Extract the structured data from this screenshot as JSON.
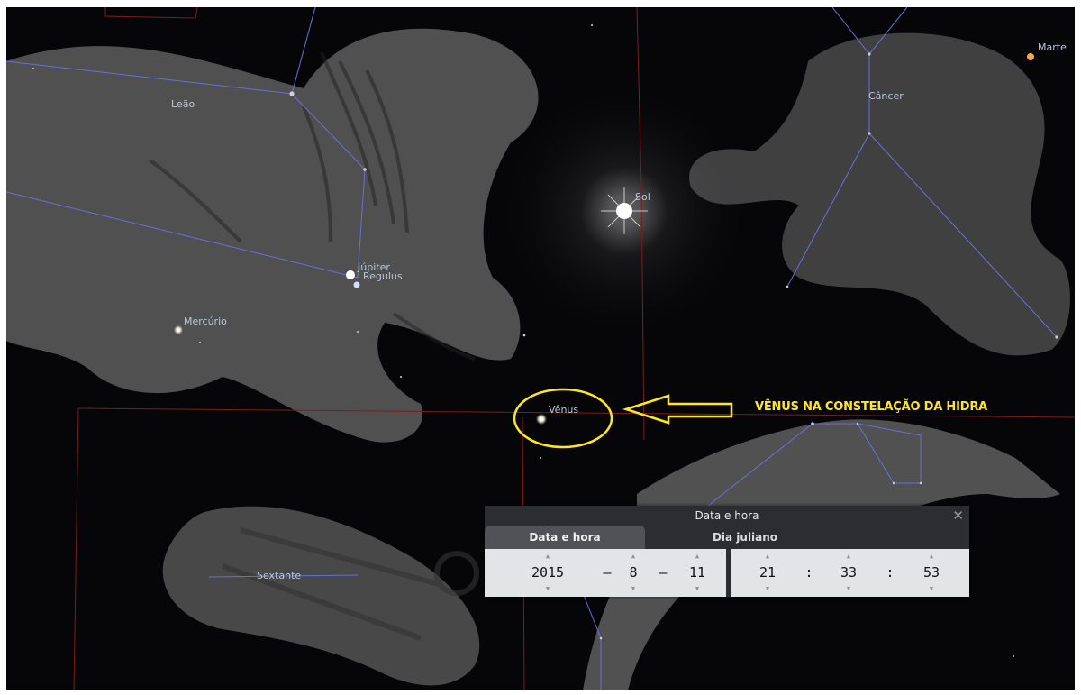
{
  "sky_labels": {
    "leao": "Leão",
    "cancer": "Câncer",
    "marte": "Marte",
    "sol": "Sol",
    "jupiter": "Júpiter",
    "regulus": "Regulus",
    "mercurio": "Mercúrio",
    "venus": "Vênus",
    "sextante": "Sextante"
  },
  "annotation": "VÊNUS NA CONSTELAÇÃO DA HIDRA",
  "colors": {
    "highlight": "#ffe81a",
    "constellation_line": "#6a6fd8",
    "boundary_line": "#8a1f1f"
  },
  "dialog": {
    "title": "Data e hora",
    "close_icon": "close-icon",
    "tabs": [
      "Data e hora",
      "Dia juliano"
    ],
    "active_tab": "Data e hora",
    "year": "2015",
    "month": "8",
    "day": "11",
    "hour": "21",
    "minute": "33",
    "second": "53",
    "date_sep": "–",
    "time_sep": ":"
  }
}
